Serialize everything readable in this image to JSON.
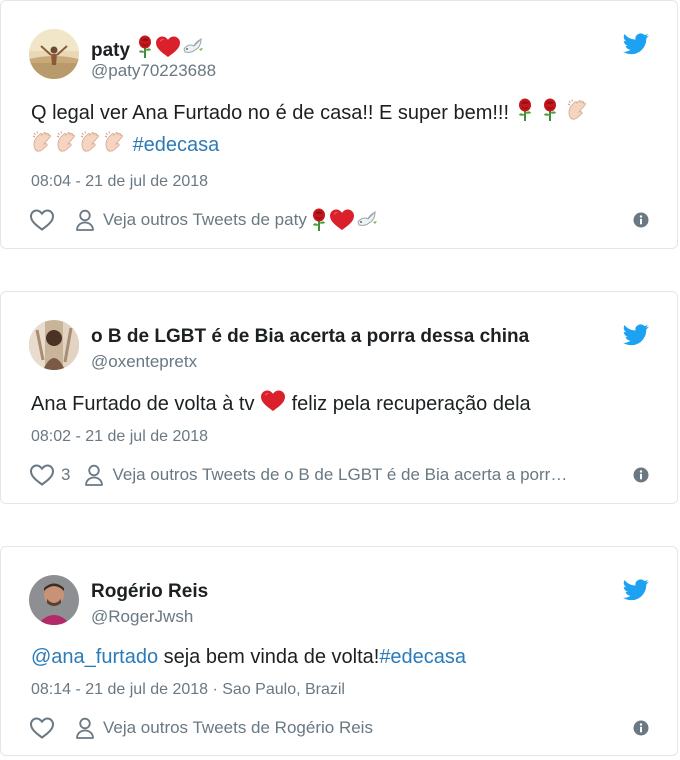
{
  "tweets": [
    {
      "name": "paty",
      "name_emoji": [
        "rose",
        "heart",
        "dove"
      ],
      "handle": "@paty70223688",
      "text_line1": "Q legal ver Ana Furtado no é de casa!! E super bem!!!",
      "text_line1_emoji": [
        "rose",
        "rose",
        "clap"
      ],
      "text_line2_emoji": [
        "clap",
        "clap",
        "clap",
        "clap"
      ],
      "hashtag": "#edecasa",
      "timestamp": "08:04 - 21 de jul de 2018",
      "likes": "",
      "more_label": "Veja outros Tweets de paty"
    },
    {
      "name": "o B de LGBT é de Bia acerta a porra dessa china",
      "handle": "@oxentepretx",
      "text_before": "Ana Furtado de volta à tv",
      "text_emoji": "heart",
      "text_after": "feliz pela recuperação dela",
      "timestamp": "08:02 - 21 de jul de 2018",
      "likes": "3",
      "more_label": "Veja outros Tweets de o B de LGBT é de Bia acerta a porr…"
    },
    {
      "name": "Rogério Reis",
      "handle": "@RogerJwsh",
      "mention": "@ana_furtado",
      "text": " seja bem vinda de volta!",
      "hashtag": "#edecasa",
      "timestamp": "08:14 - 21 de jul de 2018 · Sao Paulo, Brazil",
      "likes": "",
      "more_label": "Veja outros Tweets de Rogério Reis"
    }
  ],
  "colors": {
    "link": "#2b7bb9",
    "twitter_blue": "#1da1f2",
    "muted": "#697882",
    "border": "#e1e8ed"
  },
  "icons": [
    "twitter-bird-icon",
    "heart-icon",
    "person-icon",
    "info-icon",
    "rose-emoji",
    "heart-emoji",
    "dove-emoji",
    "clap-emoji"
  ]
}
